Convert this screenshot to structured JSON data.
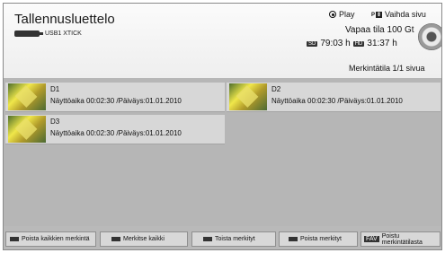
{
  "header": {
    "title": "Tallennusluettelo",
    "device": "USB1 XTICK",
    "play_label": "Play",
    "page_key": "P",
    "page_label": "Vaihda sivu",
    "free_space": "Vapaa tila 100 Gt",
    "sd_badge": "SD",
    "sd_time": "79:03 h",
    "hd_badge": "HD",
    "hd_time": "31:37 h",
    "mark_page": "Merkintätila 1/1 sivua"
  },
  "recordings": [
    {
      "title": "D1",
      "detail": "Näyttöaika 00:02:30 /Päiväys:01.01.2010"
    },
    {
      "title": "D2",
      "detail": "Näyttöaika 00:02:30 /Päiväys:01.01.2010"
    },
    {
      "title": "D3",
      "detail": "Näyttöaika 00:02:30 /Päiväys:01.01.2010"
    }
  ],
  "footer": {
    "unmark_all": "Poista kaikkien merkintä",
    "mark_all": "Merkitse kaikki",
    "play_marked": "Toista merkityt",
    "delete_marked": "Poista merkityt",
    "fav_key": "FAV",
    "exit_mark": "Poistu merkintätilasta"
  }
}
